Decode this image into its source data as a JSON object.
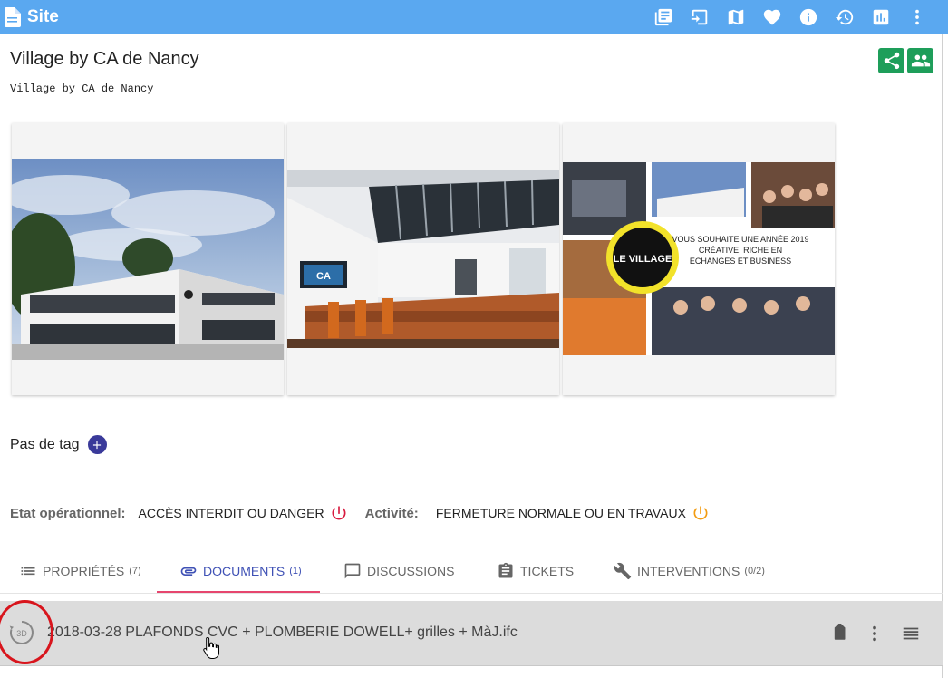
{
  "topbar": {
    "title": "Site",
    "actions": [
      {
        "icon": "library-books-icon"
      },
      {
        "icon": "exit-to-app-icon"
      },
      {
        "icon": "map-icon"
      },
      {
        "icon": "heart-icon"
      },
      {
        "icon": "info-icon"
      },
      {
        "icon": "history-icon"
      },
      {
        "icon": "bar-chart-icon"
      },
      {
        "icon": "more-vert-icon"
      }
    ]
  },
  "site": {
    "name": "Village by CA de Nancy",
    "subtitle": "Village by CA de Nancy"
  },
  "photos": [
    {
      "description": "building-exterior"
    },
    {
      "description": "interior-lobby"
    },
    {
      "description": "greeting-collage"
    }
  ],
  "collage_text": {
    "logo_main": "LE VILLAGE",
    "greeting_line1": "VOUS SOUHAITE UNE ANNÉE 2019",
    "greeting_line2": "CRÉATIVE, RICHE EN",
    "greeting_line3": "ECHANGES ET BUSINESS"
  },
  "tags": {
    "empty_label": "Pas de tag"
  },
  "status": {
    "operational_label": "Etat opérationnel:",
    "operational_value": "ACCÈS INTERDIT OU DANGER",
    "activity_label": "Activité:",
    "activity_value": "FERMETURE NORMALE OU EN TRAVAUX",
    "operational_color": "#d81b3f",
    "activity_color": "#f39c12"
  },
  "tabs": [
    {
      "label": "PROPRIÉTÉS",
      "count": "(7)"
    },
    {
      "label": "DOCUMENTS",
      "count": "(1)"
    },
    {
      "label": "DISCUSSIONS",
      "count": ""
    },
    {
      "label": "TICKETS",
      "count": ""
    },
    {
      "label": "INTERVENTIONS",
      "count": "(0/2)"
    }
  ],
  "active_tab": "DOCUMENTS",
  "documents": [
    {
      "name": "2018-03-28 PLAFONDS CVC + PLOMBERIE DOWELL+ grilles + MàJ.ifc",
      "viewer_badge": "3D"
    }
  ],
  "colors": {
    "topbar": "#5aa8f0",
    "accent_green": "#1e9e5a",
    "tab_active": "#3f51b5",
    "tab_underline": "#e6456e",
    "highlight_circle": "#d8151d"
  }
}
